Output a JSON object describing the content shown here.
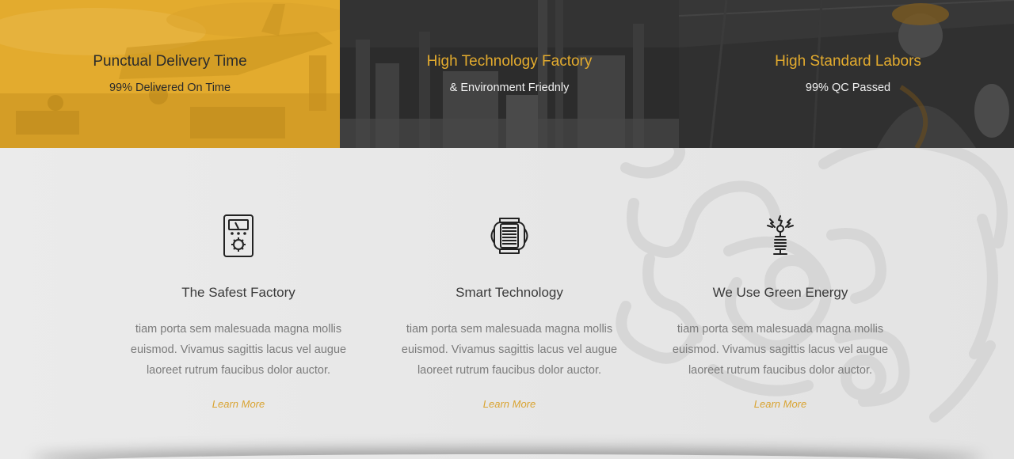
{
  "banner": {
    "tiles": [
      {
        "title": "Punctual Delivery Time",
        "subtitle": "99% Delivered On Time"
      },
      {
        "title": "High Technology Factory",
        "subtitle": "& Environment Friednly"
      },
      {
        "title": "High Standard Labors",
        "subtitle": "99% QC Passed"
      }
    ]
  },
  "features": [
    {
      "icon": "multimeter-icon",
      "title": "The Safest Factory",
      "text": "tiam porta sem malesuada magna mollis euismod. Vivamus sagittis lacus vel augue laoreet rutrum faucibus dolor auctor.",
      "link": "Learn More"
    },
    {
      "icon": "transformer-icon",
      "title": "Smart Technology",
      "text": "tiam porta sem malesuada magna mollis euismod. Vivamus sagittis lacus vel augue laoreet rutrum faucibus dolor auctor.",
      "link": "Learn More"
    },
    {
      "icon": "tesla-coil-icon",
      "title": "We Use Green Energy",
      "text": "tiam porta sem malesuada magna mollis euismod. Vivamus sagittis lacus vel augue laoreet rutrum faucibus dolor auctor.",
      "link": "Learn More"
    }
  ],
  "colors": {
    "accent": "#e3ab2e",
    "dark_tile": "#2e2e2e",
    "section_bg": "#e9e9e9",
    "body_text": "#7b7b7b",
    "heading_text": "#3a3a3a"
  }
}
